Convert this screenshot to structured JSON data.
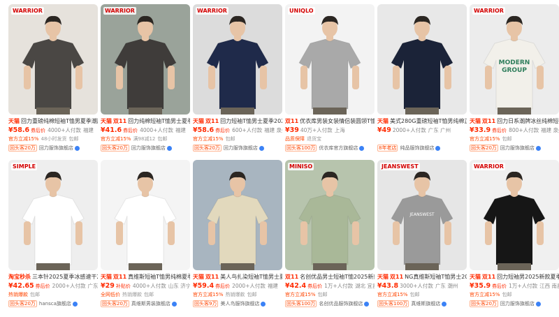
{
  "products": [
    {
      "brand_tag": "天猫",
      "title": "回力重磅纯棉短袖T恤男夏季潮牌",
      "price": "¥58.6",
      "coupon": "券后价",
      "sales": "4000+人付款",
      "location": "福建",
      "tag1": "官方立减15%",
      "tag2": "48小时发货",
      "tag3": "包邮",
      "shop_badge": "回头客20万",
      "shop": "回力服饰旗舰店",
      "thumb_bg": "#e6e2dc",
      "shirt": "#4a4744",
      "logo": "WARRIOR"
    },
    {
      "brand_tag": "天猫",
      "brand_tag2": "双11",
      "title": "回力纯棉短袖T恤男士夏季20",
      "price": "¥41.6",
      "coupon": "券后价",
      "sales": "4000+人付款",
      "location": "福建",
      "tag1": "官方立减15%",
      "tag2": "满98减12",
      "tag3": "包邮",
      "shop_badge": "回头客20万",
      "shop": "回力服饰旗舰店",
      "thumb_bg": "#9aa39a",
      "shirt": "#3f3c3a",
      "logo": "WARRIOR"
    },
    {
      "brand_tag": "天猫",
      "brand_tag2": "双11",
      "title": "回力短袖T恤男士夏季2025新款",
      "price": "¥58.6",
      "coupon": "券后价",
      "sales": "600+人付款",
      "location": "福建 泉州",
      "tag1": "官方立减15%",
      "tag2": "包邮",
      "tag3": "",
      "shop_badge": "回头客20万",
      "shop": "回力服饰旗舰店",
      "thumb_bg": "#dcdcdc",
      "shirt": "#1f2a4a",
      "logo": "WARRIOR"
    },
    {
      "brand_tag": "",
      "brand_tag2": "双11",
      "title": "优衣库男装女装情侣装圆领T恤",
      "price": "¥39",
      "coupon": "",
      "sales": "40万+人付款",
      "location": "上海",
      "tag1": "品质保障",
      "tag2": "退货宝",
      "tag3": "",
      "shop_badge": "回头客100万",
      "shop": "优衣库官方旗舰店",
      "thumb_bg": "#f3f3f3",
      "shirt": "#a9a9a9",
      "logo": "UNIQLO"
    },
    {
      "brand_tag": "天猫",
      "title": "美式280G重磅短袖T恤男纯棉正肩",
      "price": "¥49",
      "coupon": "",
      "sales": "2000+人付款",
      "location": "广东 广州",
      "tag1": "",
      "tag2": "",
      "tag3": "",
      "shop_badge": "8年老店",
      "shop": "纯品服饰旗舰店",
      "thumb_bg": "#e8e8e8",
      "shirt": "#1b2338",
      "logo": ""
    },
    {
      "brand_tag": "天猫",
      "brand_tag2": "双11",
      "title": "回力日系潮牌冰丝纯棉短袖T恤",
      "price": "¥33.9",
      "coupon": "券后价",
      "sales": "800+人付款",
      "location": "福建 泉州",
      "tag1": "官方立减15%",
      "tag2": "包邮",
      "tag3": "",
      "shop_badge": "回头客20万",
      "shop": "回力服饰旗舰店",
      "thumb_bg": "#ececec",
      "shirt": "#f2f0ea",
      "logo": "WARRIOR"
    },
    {
      "brand_tag": "淘宝秒杀",
      "title": "三本针2025夏季冰感速干26",
      "price": "¥42.65",
      "coupon": "券后价",
      "sales": "2000+人付款",
      "location": "广东",
      "tag1": "热销爆款",
      "tag2": "包邮",
      "tag3": "",
      "shop_badge": "回头客20万",
      "shop": "hansca旗舰店",
      "thumb_bg": "#eeeeee",
      "shirt": "#ffffff",
      "logo": "SIMPLE"
    },
    {
      "brand_tag": "天猫",
      "brand_tag2": "双11",
      "title": "真维斯短袖T恤男纯棉夏季男款",
      "price": "¥29",
      "coupon": "补贴价",
      "sales": "4000+人付款",
      "location": "山东 济宁",
      "tag1": "全网低价",
      "tag2": "热销爆款",
      "tag3": "包邮",
      "shop_badge": "回头客20万",
      "shop": "真维斯男装旗舰店",
      "thumb_bg": "#f4f4f4",
      "shirt": "#ffffff",
      "logo": ""
    },
    {
      "brand_tag": "天猫",
      "brand_tag2": "双11",
      "title": "美人鸟扎染短袖T恤男士夏季",
      "price": "¥59.4",
      "coupon": "券后价",
      "sales": "2000+人付款",
      "location": "福建",
      "tag1": "官方立减15%",
      "tag2": "热销爆款",
      "tag3": "包邮",
      "shop_badge": "回头客9万",
      "shop": "美人鸟服饰旗舰店",
      "thumb_bg": "#a8b5c0",
      "shirt": "#e2d9bd",
      "logo": ""
    },
    {
      "brand_tag": "",
      "brand_tag2": "双11",
      "title": "名创优品男士短袖T恤2025新款",
      "price": "¥42.4",
      "coupon": "券后价",
      "sales": "1万+人付款",
      "location": "湖北 宜昌",
      "tag1": "官方立减15%",
      "tag2": "包邮",
      "tag3": "",
      "shop_badge": "回头客100万",
      "shop": "名创优品服饰旗舰店",
      "thumb_bg": "#b7c4ad",
      "shirt": "#a9b898",
      "logo": "MINISO"
    },
    {
      "brand_tag": "天猫",
      "brand_tag2": "双11",
      "title": "NG真维斯短袖T恤男士202",
      "price": "¥43.8",
      "coupon": "",
      "sales": "3000+人付款",
      "location": "广东 潮州",
      "tag1": "官方立减15%",
      "tag2": "包邮",
      "tag3": "",
      "shop_badge": "回头客100万",
      "shop": "真维斯旗舰店",
      "thumb_bg": "#e6e6e6",
      "shirt": "#9a9a9a",
      "logo": "JEANSWEST"
    },
    {
      "brand_tag": "天猫",
      "brand_tag2": "双11",
      "title": "回力短袖男2025新款夏季",
      "price": "¥35.9",
      "coupon": "券后价",
      "sales": "1万+人付款",
      "location": "江西 南昌",
      "tag1": "官方立减15%",
      "tag2": "包邮",
      "tag3": "",
      "shop_badge": "回头客20万",
      "shop": "回力服饰旗舰店",
      "thumb_bg": "#f0f0f0",
      "shirt": "#161616",
      "logo": "WARRIOR"
    }
  ]
}
